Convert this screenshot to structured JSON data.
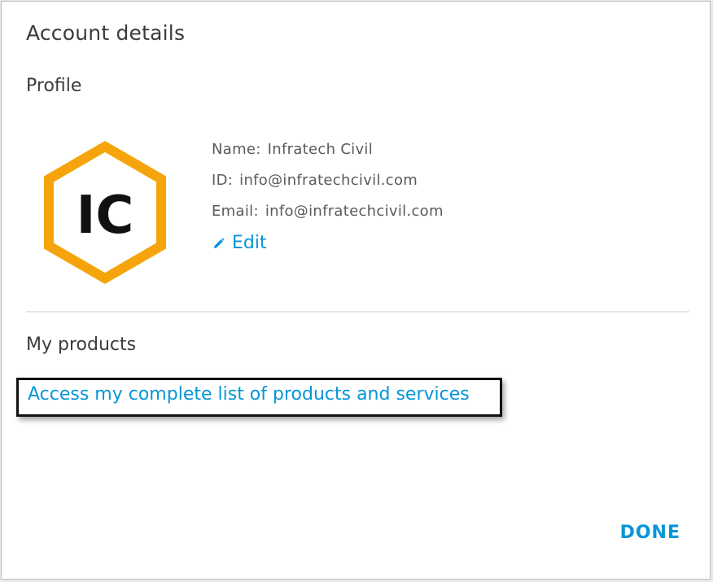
{
  "dialog": {
    "title": "Account details"
  },
  "profile": {
    "section_title": "Profile",
    "avatar": {
      "initials": "IC",
      "ring_color": "#f5a50b",
      "text_color": "#111111"
    },
    "name_label": "Name:",
    "name_value": "Infratech Civil",
    "id_label": "ID:",
    "id_value": "info@infratechcivil.com",
    "email_label": "Email:",
    "email_value": "info@infratechcivil.com",
    "edit_icon": "pencil-icon",
    "edit_label": "Edit"
  },
  "products": {
    "section_title": "My products",
    "link_label": "Access my complete list of products and services"
  },
  "footer": {
    "done_label": "DONE"
  },
  "colors": {
    "accent": "#0696d7",
    "heading": "#3c3c3c",
    "body_text": "#5a5a5a"
  }
}
